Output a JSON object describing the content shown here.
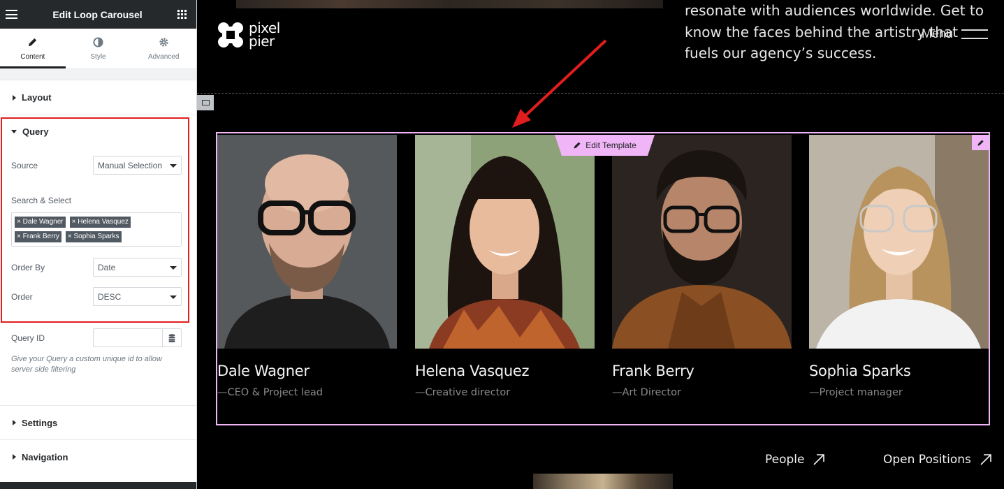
{
  "panel": {
    "title": "Edit Loop Carousel",
    "tabs": [
      {
        "label": "Content",
        "icon": "pencil-icon"
      },
      {
        "label": "Style",
        "icon": "contrast-icon"
      },
      {
        "label": "Advanced",
        "icon": "gear-icon"
      }
    ],
    "sections": {
      "layout": "Layout",
      "query": "Query",
      "settings": "Settings",
      "navigation": "Navigation"
    },
    "query": {
      "source_label": "Source",
      "source_value": "Manual Selection",
      "search_label": "Search & Select",
      "selected": [
        "Dale Wagner",
        "Helena Vasquez",
        "Frank Berry",
        "Sophia Sparks"
      ],
      "order_by_label": "Order By",
      "order_by_value": "Date",
      "order_label": "Order",
      "order_value": "DESC",
      "query_id_label": "Query ID",
      "query_id_value": "",
      "query_id_help": "Give your Query a custom unique id to allow server side filtering"
    }
  },
  "site": {
    "logo_line1": "pixel",
    "logo_line2": "pier",
    "intro": "resonate with audiences worldwide. Get to know the faces behind the artistry that fuels our agency’s success.",
    "menu_label": "Menu",
    "edit_template": "Edit Template",
    "team": [
      {
        "name": "Dale Wagner",
        "role": "—CEO & Project lead"
      },
      {
        "name": "Helena Vasquez",
        "role": "—Creative director"
      },
      {
        "name": "Frank Berry",
        "role": "—Art Director"
      },
      {
        "name": "Sophia Sparks",
        "role": "—Project manager"
      }
    ],
    "links": [
      {
        "label": "People",
        "icon": "arrow-up-right-icon"
      },
      {
        "label": "Open Positions",
        "icon": "arrow-up-right-icon"
      }
    ]
  },
  "colors": {
    "accent_pink": "#f0b5f7",
    "highlight_red": "#e11d1d",
    "panel_dark": "#26292c"
  }
}
